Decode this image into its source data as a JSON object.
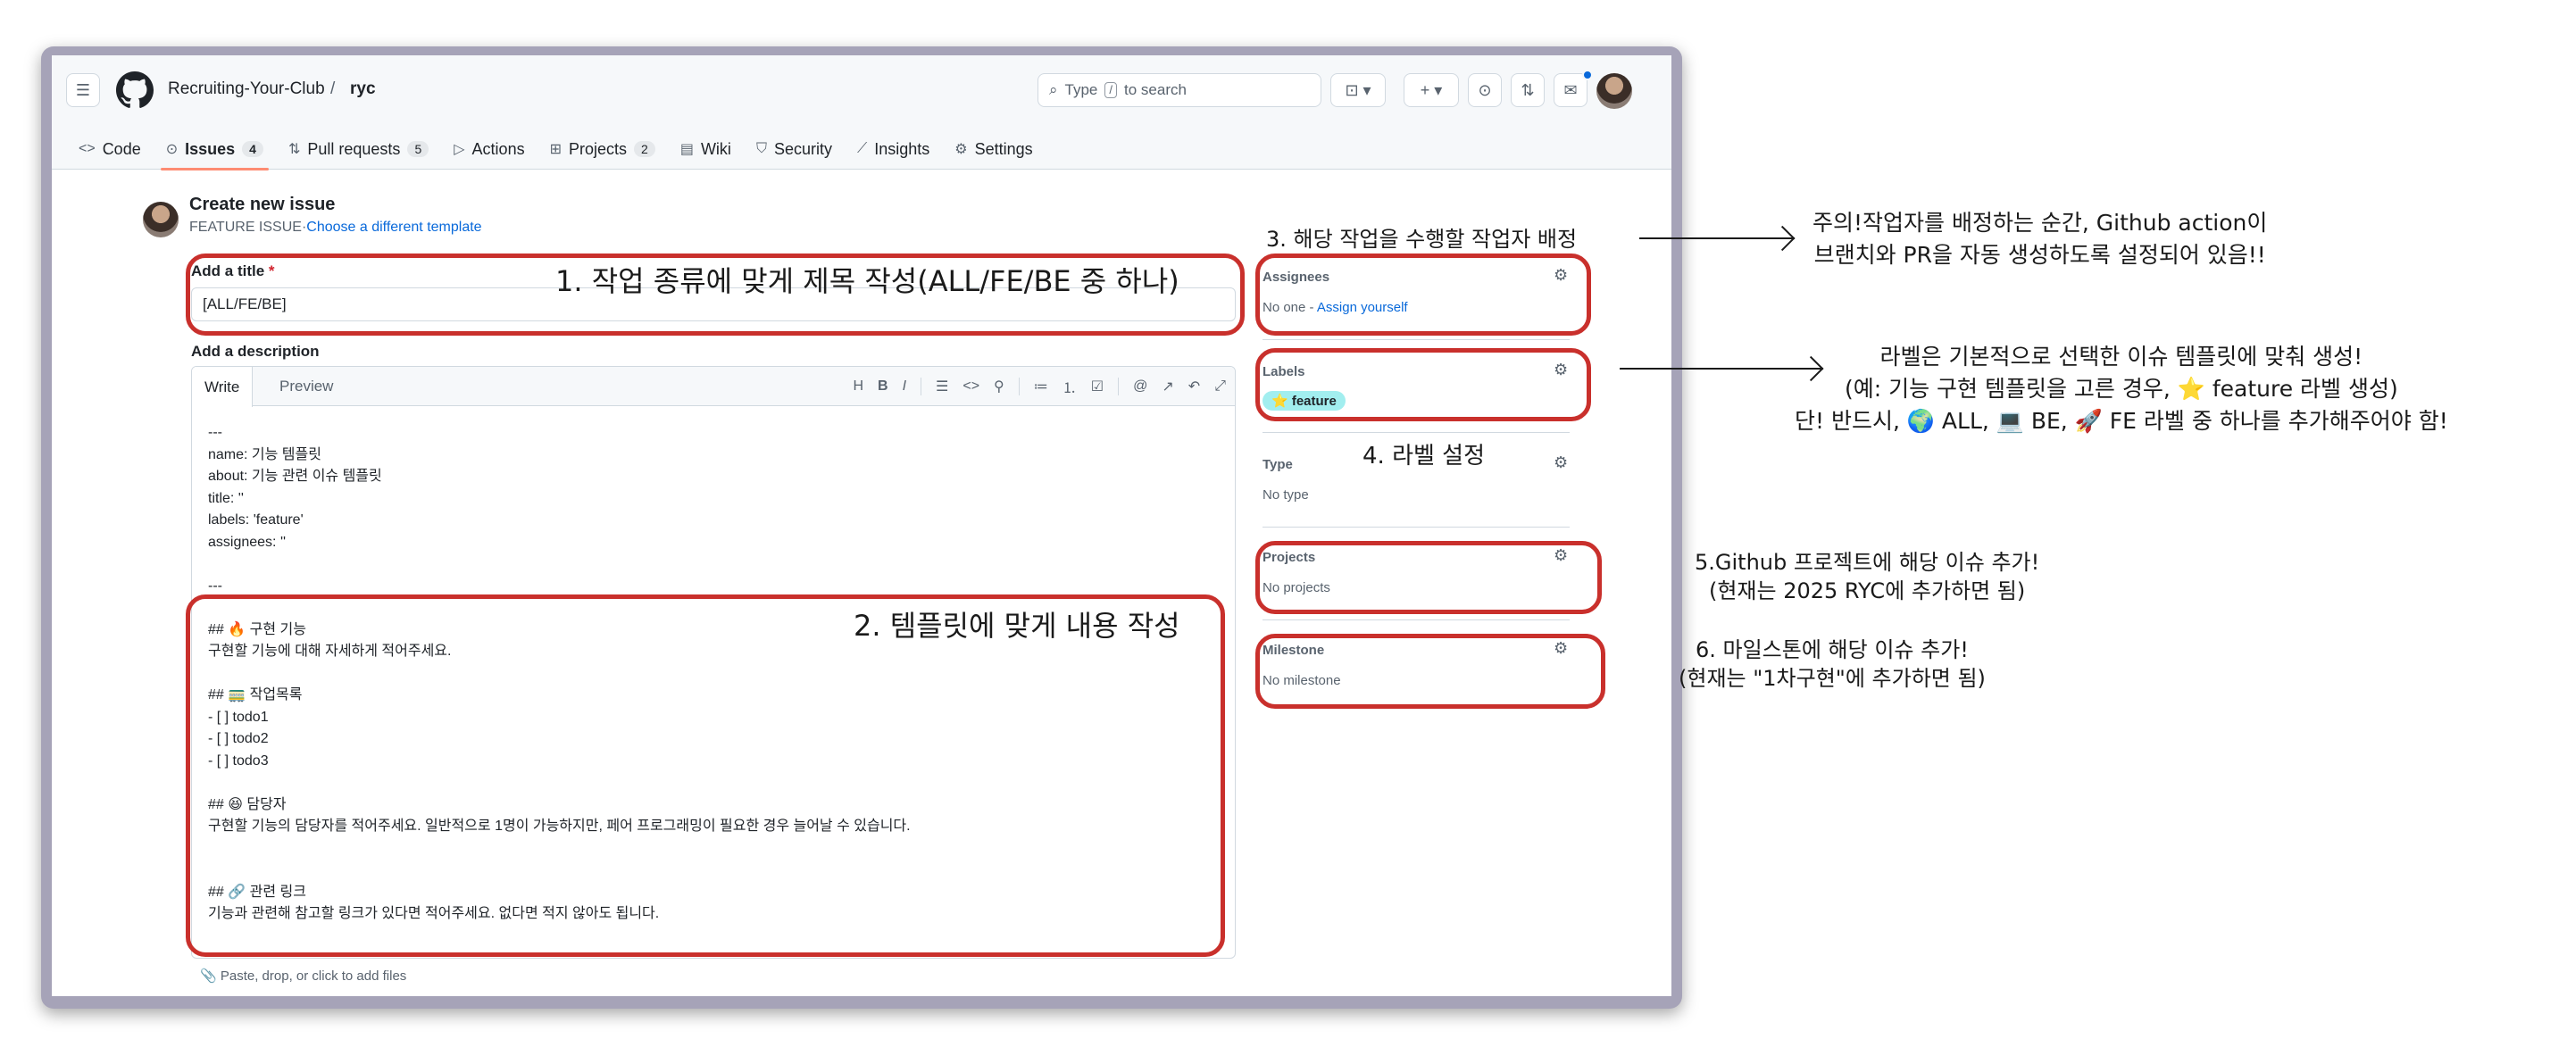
{
  "header": {
    "owner": "Recruiting-Your-Club",
    "separator": "/",
    "repo": "ryc",
    "search_text": "Type",
    "search_key": "/",
    "search_suffix": "to search"
  },
  "tabs": [
    {
      "label": "Code",
      "icon": "code-icon"
    },
    {
      "label": "Issues",
      "count": "4",
      "icon": "issue-icon"
    },
    {
      "label": "Pull requests",
      "count": "5",
      "icon": "pull-request-icon"
    },
    {
      "label": "Actions",
      "icon": "play-icon"
    },
    {
      "label": "Projects",
      "count": "2",
      "icon": "table-icon"
    },
    {
      "label": "Wiki",
      "icon": "book-icon"
    },
    {
      "label": "Security",
      "icon": "shield-icon"
    },
    {
      "label": "Insights",
      "icon": "graph-icon"
    },
    {
      "label": "Settings",
      "icon": "gear-icon"
    }
  ],
  "issue": {
    "page_title": "Create new issue",
    "template_name": "FEATURE ISSUE",
    "template_sep": "·",
    "template_link": "Choose a different template",
    "title_label": "Add a title",
    "required_mark": "*",
    "title_value": "[ALL/FE/BE]",
    "description_label": "Add a description",
    "write_tab": "Write",
    "preview_tab": "Preview",
    "body": "---\nname: 기능 템플릿\nabout: 기능 관련 이슈 템플릿\ntitle: ''\nlabels: 'feature'\nassignees: ''\n\n---\n\n## 🔥 구현 기능\n구현할 기능에 대해 자세하게 적어주세요.\n\n## 🚃 작업목록\n- [ ] todo1\n- [ ] todo2\n- [ ] todo3\n\n## 😆 담당자\n구현할 기능의 담당자를 적어주세요. 일반적으로 1명이 가능하지만, 페어 프로그래밍이 필요한 경우 늘어날 수 있습니다.\n\n\n## 🔗 관련 링크\n기능과 관련해 참고할 링크가 있다면 적어주세요. 없다면 적지 않아도 됩니다.",
    "paste_hint": "Paste, drop, or click to add files"
  },
  "sidebar": {
    "assignees_title": "Assignees",
    "assignees_value": "No one -",
    "assign_yourself": "Assign yourself",
    "labels_title": "Labels",
    "label_badge": "⭐ feature",
    "type_title": "Type",
    "type_value": "No type",
    "projects_title": "Projects",
    "projects_value": "No projects",
    "milestone_title": "Milestone",
    "milestone_value": "No milestone"
  },
  "annotations": {
    "a1": "1. 작업 종류에 맞게 제목 작성(ALL/FE/BE 중 하나)",
    "a2": "2. 템플릿에 맞게 내용 작성",
    "a3": "3. 해당 작업을 수행할 작업자 배정",
    "a4": "4. 라벨 설정",
    "a5": "5.Github 프로젝트에 해당 이슈 추가!\n(현재는 2025 RYC에 추가하면 됨)",
    "a6": "6. 마일스톤에 해당 이슈 추가!\n(현재는 \"1차구현\"에 추가하면 됨)",
    "note_assignee": "주의!작업자를 배정하는 순간, Github action이\n브랜치와 PR을 자동 생성하도록 설정되어 있음!!",
    "note_labels": "라벨은 기본적으로 선택한 이슈 템플릿에 맞춰 생성!\n(예: 기능 구현 템플릿을 고른 경우, ⭐ feature 라벨 생성)\n단! 반드시, 🌍 ALL, 💻 BE, 🚀 FE 라벨 중 하나를 추가해주어야 함!"
  },
  "colors": {
    "annotation_box": "#c9302c",
    "active_tab_underline": "#fd8c73",
    "link": "#0969da",
    "label_badge_bg": "#a2eeef"
  }
}
